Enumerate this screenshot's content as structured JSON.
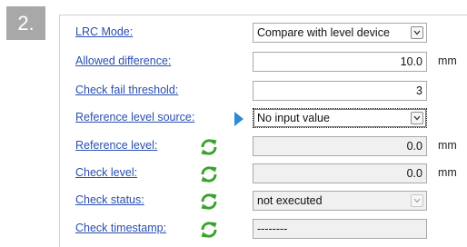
{
  "step_number": "2.",
  "rows": [
    {
      "label": "LRC Mode:",
      "value": "Compare with level device",
      "unit": "",
      "type": "dropdown"
    },
    {
      "label": "Allowed difference:",
      "value": "10.0",
      "unit": "mm",
      "type": "number"
    },
    {
      "label": "Check fail threshold:",
      "value": "3",
      "unit": "",
      "type": "number"
    },
    {
      "label": "Reference level source:",
      "value": "No input value",
      "unit": "",
      "type": "dropdown-focused"
    },
    {
      "label": "Reference level:",
      "value": "0.0",
      "unit": "mm",
      "type": "readonly"
    },
    {
      "label": "Check level:",
      "value": "0.0",
      "unit": "mm",
      "type": "readonly"
    },
    {
      "label": "Check status:",
      "value": "not executed",
      "unit": "",
      "type": "dropdown-disabled"
    },
    {
      "label": "Check timestamp:",
      "value": "--------",
      "unit": "",
      "type": "readonly"
    }
  ],
  "icons": {
    "sync_icon": "refresh-arrows-icon",
    "pointer_icon": "arrow-right-icon",
    "dropdown_icon": "chevron-down-icon"
  },
  "colors": {
    "label_link": "#2a4fb0",
    "sync_icon": "#3aa22c",
    "pointer": "#2b8ad6",
    "badge_bg": "#a8a8a8"
  }
}
